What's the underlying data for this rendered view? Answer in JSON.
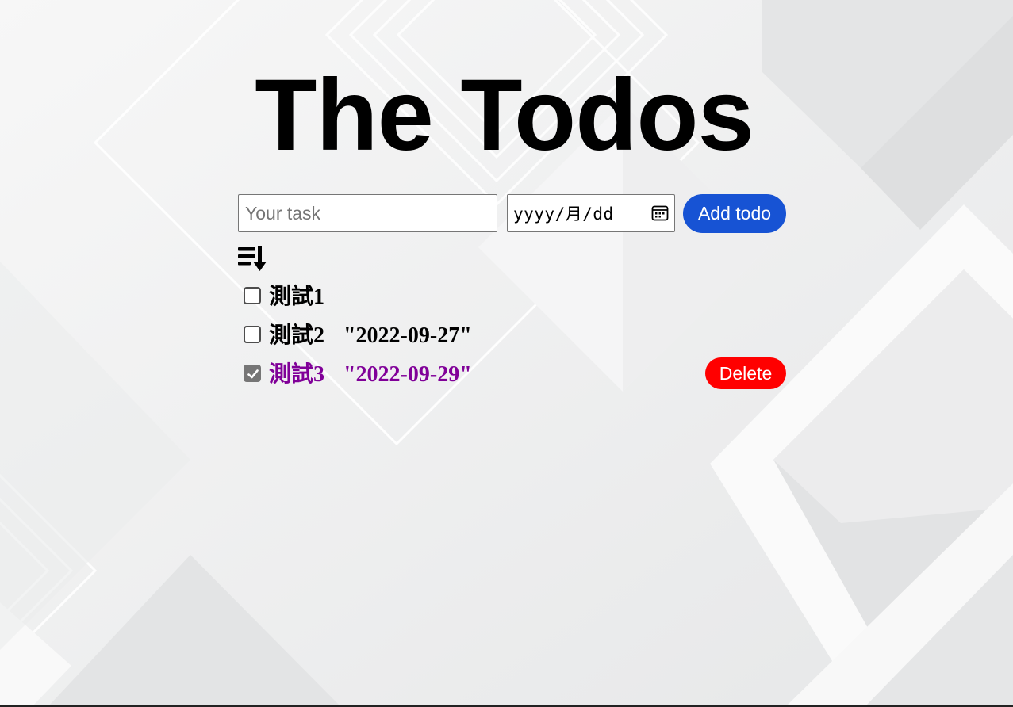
{
  "header": {
    "title": "The Todos"
  },
  "form": {
    "task_placeholder": "Your task",
    "task_value": "",
    "date_placeholder": "yyyy/月/dd",
    "add_label": "Add todo"
  },
  "toolbar": {
    "sort_icon": "sort-descending-icon"
  },
  "todos": [
    {
      "text": "測試1",
      "date": "",
      "checked": false
    },
    {
      "text": "測試2",
      "date": "\"2022-09-27\"",
      "checked": false
    },
    {
      "text": "測試3",
      "date": "\"2022-09-29\"",
      "checked": true,
      "delete_label": "Delete"
    }
  ],
  "colors": {
    "add_button": "#1753d4",
    "delete_button": "#ff0000",
    "done_text": "#800098",
    "checkbox_checked": "#767676"
  }
}
